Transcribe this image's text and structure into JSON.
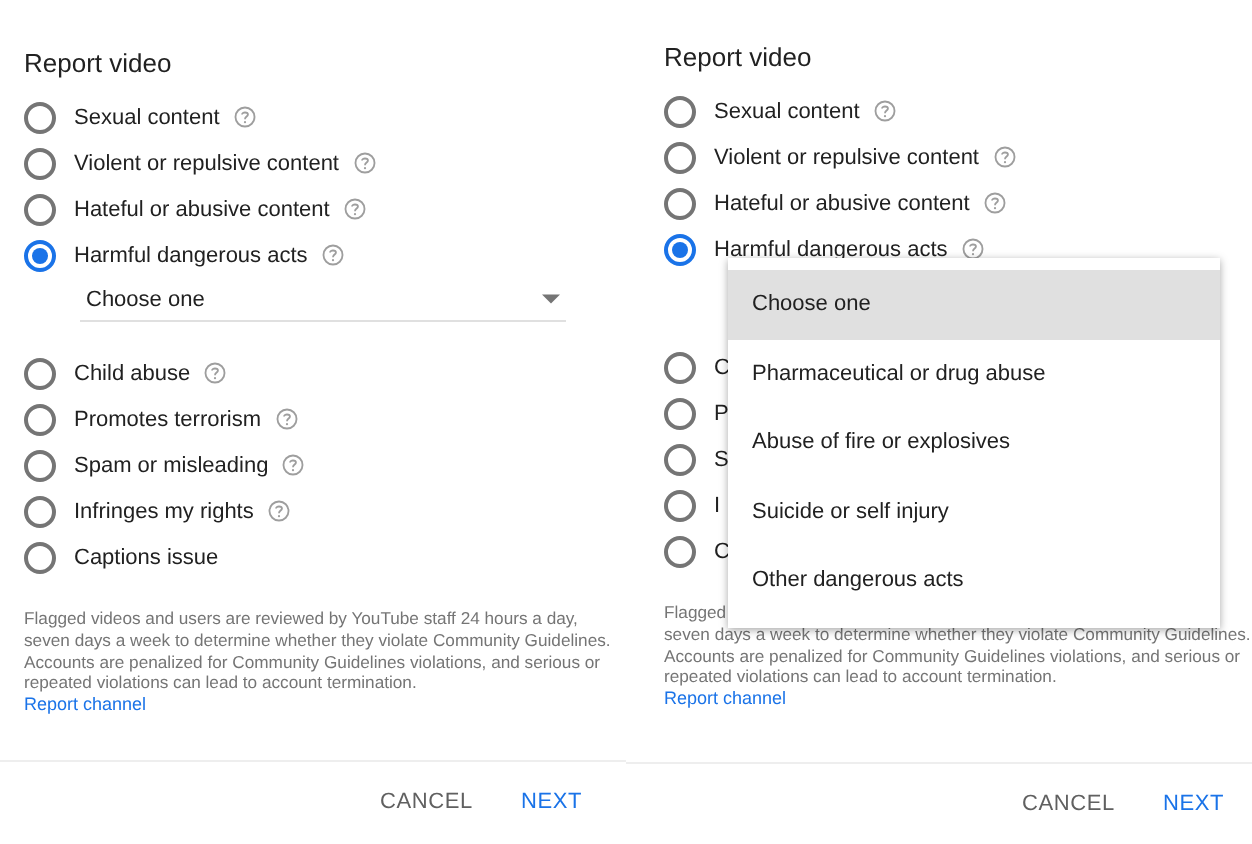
{
  "panels": [
    {
      "title": "Report video",
      "options": [
        {
          "label": "Sexual content",
          "selected": false,
          "help": true
        },
        {
          "label": "Violent or repulsive content",
          "selected": false,
          "help": true
        },
        {
          "label": "Hateful or abusive content",
          "selected": false,
          "help": true
        },
        {
          "label": "Harmful dangerous acts",
          "selected": true,
          "help": true
        },
        {
          "label": "Child abuse",
          "selected": false,
          "help": true
        },
        {
          "label": "Promotes terrorism",
          "selected": false,
          "help": true
        },
        {
          "label": "Spam or misleading",
          "selected": false,
          "help": true
        },
        {
          "label": "Infringes my rights",
          "selected": false,
          "help": true
        },
        {
          "label": "Captions issue",
          "selected": false,
          "help": false
        }
      ],
      "category_select": {
        "value": "Choose one"
      },
      "notice": [
        "Flagged videos and users are reviewed by YouTube staff 24 hours a day, seven days a week to determine whether they violate Community Guidelines. Accounts are penalized for Community Guidelines violations, and serious or repeated violations can lead to account termination."
      ],
      "link": "Report channel",
      "buttons": [
        {
          "label": "CANCEL",
          "kind": "secondary"
        },
        {
          "label": "NEXT",
          "kind": "primary"
        }
      ]
    },
    {
      "title": "Report video",
      "options": [
        {
          "label": "Sexual content",
          "selected": false,
          "help": true
        },
        {
          "label": "Violent or repulsive content",
          "selected": false,
          "help": true
        },
        {
          "label": "Hateful or abusive content",
          "selected": false,
          "help": true
        },
        {
          "label": "Harmful dangerous acts",
          "selected": true,
          "help": true
        },
        {
          "label": "C",
          "selected": false,
          "help": false
        },
        {
          "label": "P",
          "selected": false,
          "help": false
        },
        {
          "label": "S",
          "selected": false,
          "help": false
        },
        {
          "label": "I",
          "selected": false,
          "help": false
        },
        {
          "label": "C",
          "selected": false,
          "help": false
        }
      ],
      "category_menu": {
        "items": [
          {
            "label": "Choose one",
            "selected": true
          },
          {
            "label": "Pharmaceutical or drug abuse",
            "selected": false
          },
          {
            "label": "Abuse of fire or explosives",
            "selected": false
          },
          {
            "label": "Suicide or self injury",
            "selected": false
          },
          {
            "label": "Other dangerous acts",
            "selected": false
          }
        ]
      },
      "notice": [
        "Flagged",
        "seven days a week to determine whether they violate Community Guidelines. Accounts are penalized for Community Guidelines violations, and serious or repeated violations can lead to account termination."
      ],
      "link": "Report channel",
      "buttons": [
        {
          "label": "CANCEL",
          "kind": "secondary"
        },
        {
          "label": "NEXT",
          "kind": "primary"
        }
      ]
    }
  ]
}
